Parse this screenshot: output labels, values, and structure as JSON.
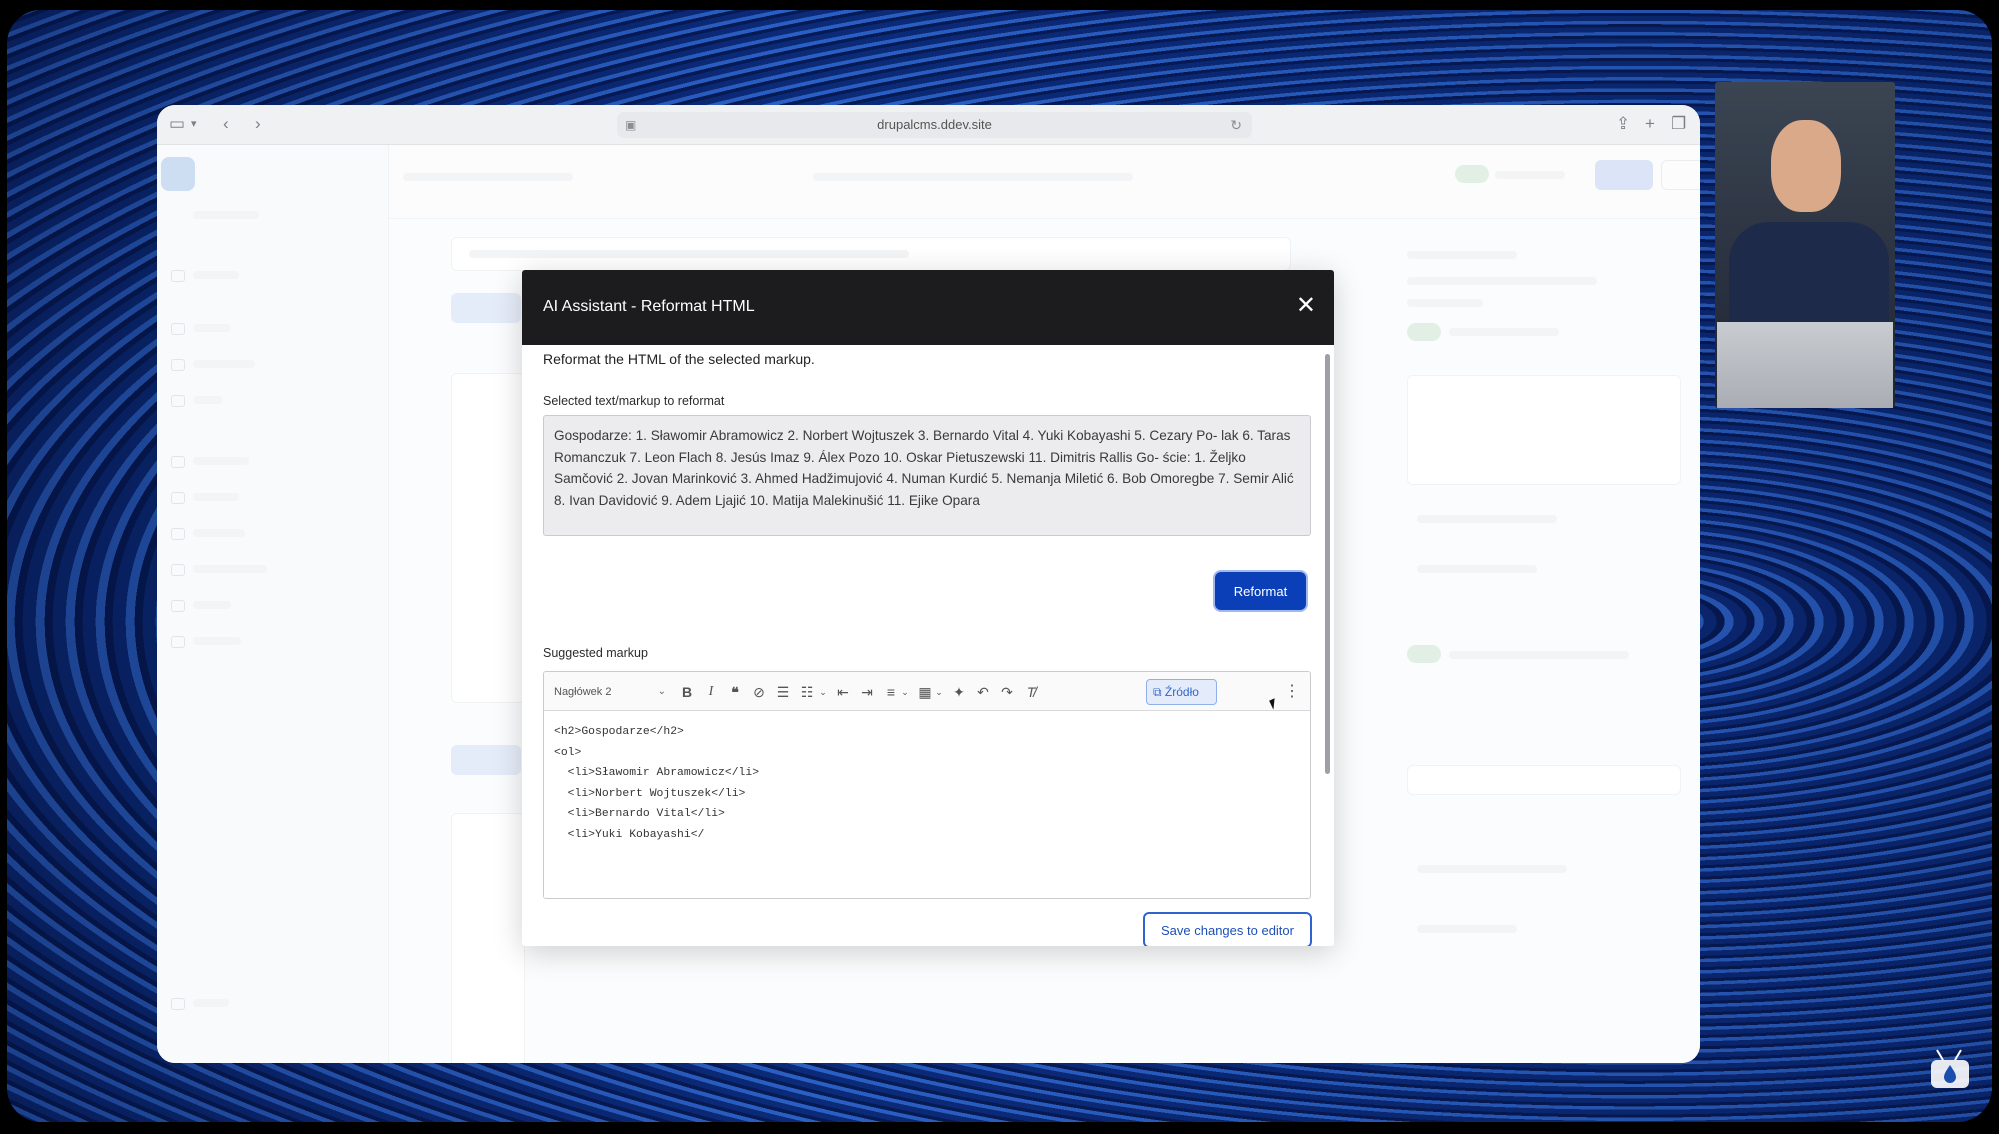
{
  "browser": {
    "url": "drupalcms.ddev.site"
  },
  "modal": {
    "title": "AI Assistant - Reformat HTML",
    "description": "Reformat the HTML of the selected markup.",
    "selected_label": "Selected text/markup to reformat",
    "selected_text": "Gospodarze: 1. Sławomir Abramowicz 2. Norbert Wojtuszek 3. Bernardo Vital 4. Yuki Kobayashi 5. Cezary Po- lak 6. Taras Romanczuk 7. Leon Flach 8. Jesús Imaz 9. Álex Pozo 10. Oskar Pietuszewski 11. Dimitris Rallis Go- ście: 1. Željko Samčović 2. Jovan Marinković 3. Ahmed Hadžimujović 4. Numan Kurdić 5. Nemanja Miletić 6. Bob Omoregbe 7. Semir Alić 8. Ivan Davidović 9. Adem Ljajić 10. Matija Malekinušić 11. Ejike Opara",
    "reformat_label": "Reformat",
    "suggested_label": "Suggested markup",
    "heading_select": "Nagłówek 2",
    "source_label": "Źródło",
    "code_lines": [
      "<h2>Gospodarze</h2>",
      "<ol>",
      "  <li>Sławomir Abramowicz</li>",
      "  <li>Norbert Wojtuszek</li>",
      "  <li>Bernardo Vital</li>",
      "  <li>Yuki Kobayashi</"
    ],
    "save_label": "Save changes to editor"
  },
  "icons": {
    "close": "close-icon",
    "bold": "B",
    "italic": "I",
    "quote": "quote-icon"
  }
}
